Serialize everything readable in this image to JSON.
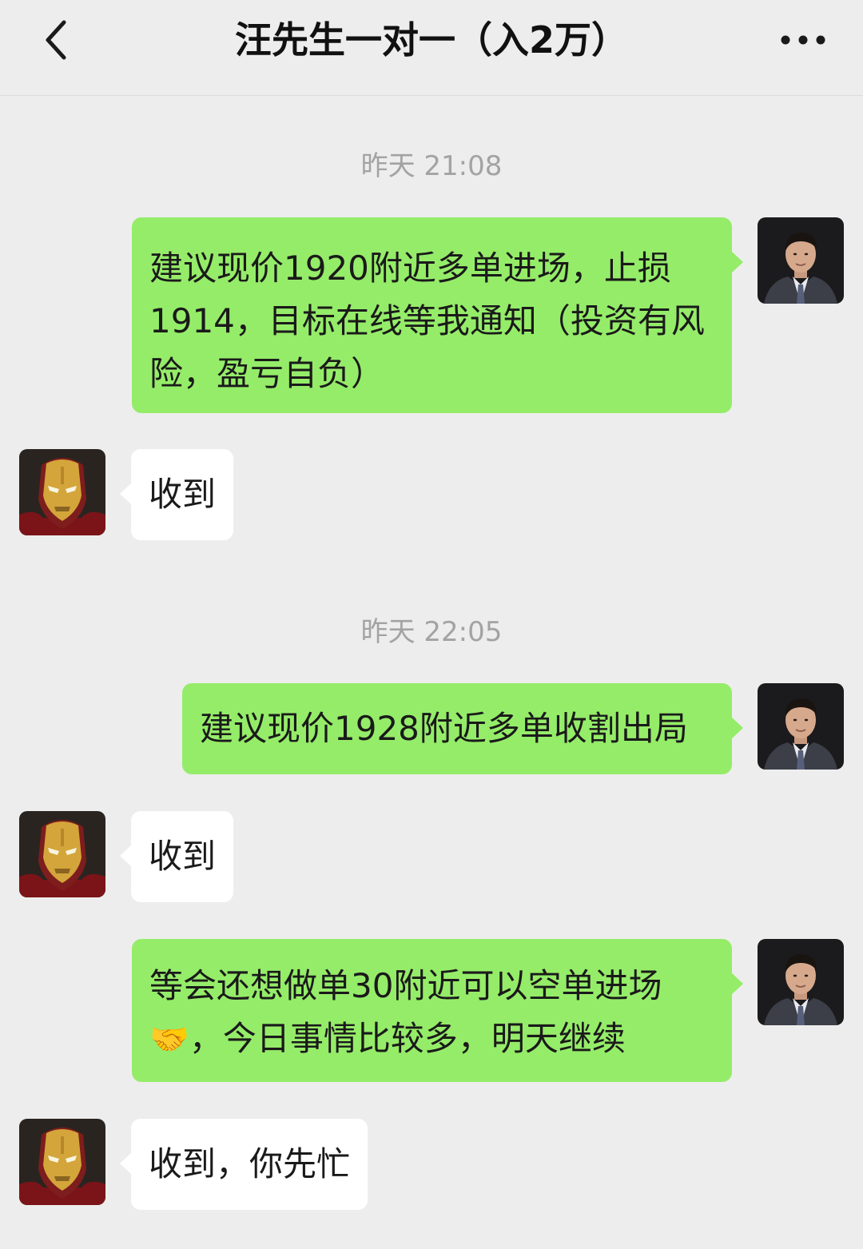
{
  "header": {
    "title": "汪先生一对一（入2万）",
    "back_icon": "chevron-left-icon",
    "more_icon": "more-dots-icon"
  },
  "timestamps": [
    "昨天 21:08",
    "昨天 22:05"
  ],
  "messages": [
    {
      "sender": "self",
      "avatar": "man-in-suit",
      "text": "建议现价1920附近多单进场，止损1914，目标在线等我通知（投资有风险，盈亏自负）"
    },
    {
      "sender": "other",
      "avatar": "iron-man-helmet",
      "text": "收到"
    },
    {
      "sender": "self",
      "avatar": "man-in-suit",
      "text": "建议现价1928附近多单收割出局"
    },
    {
      "sender": "other",
      "avatar": "iron-man-helmet",
      "text": "收到"
    },
    {
      "sender": "self",
      "avatar": "man-in-suit",
      "text_before": "等会还想做单30附近可以空单进场",
      "emoji": "🤝",
      "text_after": "，今日事情比较多，明天继续"
    },
    {
      "sender": "other",
      "avatar": "iron-man-helmet",
      "text": "收到，你先忙"
    }
  ],
  "colors": {
    "background": "#ededed",
    "outgoing_bubble": "#95ec69",
    "incoming_bubble": "#ffffff",
    "timestamp": "#a3a3a3"
  }
}
